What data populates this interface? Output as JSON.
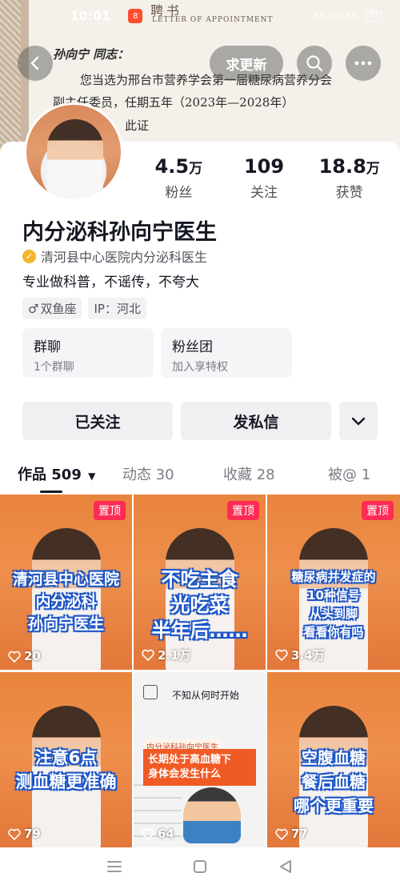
{
  "status_bar": {
    "time": "10:01",
    "app_badge": "8",
    "battery": "71",
    "network": "5G HD 5G"
  },
  "cover": {
    "header": "聘书",
    "subheader": "LETTER OF APPOINTMENT",
    "line1": "孙向宁 同志：",
    "line2": "您当选为邢台市营养学会第一届糖尿病营养分会",
    "line3": "副主任委员，任期五年（2023年—2028年）",
    "line4": "此证"
  },
  "top_bar": {
    "update_label": "求更新"
  },
  "profile": {
    "stats": [
      {
        "num": "4.5",
        "unit": "万",
        "label": "粉丝"
      },
      {
        "num": "109",
        "unit": "",
        "label": "关注"
      },
      {
        "num": "18.8",
        "unit": "万",
        "label": "获赞"
      }
    ],
    "name": "内分泌科孙向宁医生",
    "verification": "清河县中心医院内分泌科医生",
    "bio": "专业做科普，不谣传，不夸大",
    "tags": [
      "双鱼座",
      "IP：河北"
    ]
  },
  "cards": [
    {
      "title": "群聊",
      "sub": "1个群聊"
    },
    {
      "title": "粉丝团",
      "sub": "加入享特权"
    }
  ],
  "actions": {
    "followed": "已关注",
    "message": "发私信"
  },
  "tabs": {
    "works": "作品 509",
    "dynamic": "动态 30",
    "favorites": "收藏 28",
    "mentioned": "被@ 1"
  },
  "videos": [
    {
      "pinned": "置顶",
      "overlay": "清河县中心医院\n内分泌科\n孙向宁医生",
      "likes": "20"
    },
    {
      "pinned": "置顶",
      "overlay": "不吃主食\n光吃菜\n半年后……",
      "likes": "2.1万"
    },
    {
      "pinned": "置顶",
      "overlay": "糖尿病并发症的\n10种信号\n从头到脚\n看看你有吗",
      "likes": "3.4万"
    },
    {
      "pinned": "",
      "overlay": "注意6点\n测血糖更准确",
      "likes": "79"
    },
    {
      "pinned": "",
      "caption": "不知从何时开始",
      "banner_title": "内分泌科孙向宁医生",
      "banner": "长期处于高血糖下\n身体会发生什么",
      "likes": "64"
    },
    {
      "pinned": "",
      "overlay": "空腹血糖\n餐后血糖\n哪个更重要",
      "likes": "77"
    }
  ],
  "colors": {
    "accent_red": "#fe2c55",
    "verify_gold": "#f3b52b",
    "tile_orange": "#e9843d",
    "overlay_blue": "#1d56c7"
  }
}
